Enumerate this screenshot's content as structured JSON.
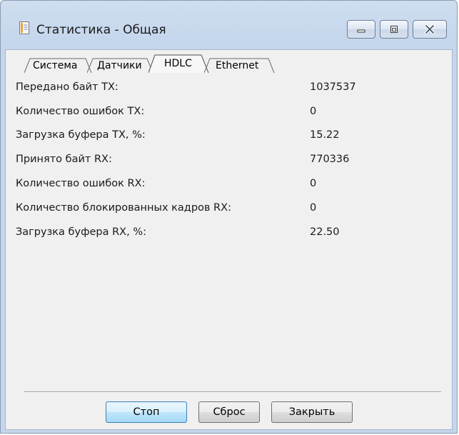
{
  "window": {
    "title": "Статистика - Общая",
    "caption_buttons": [
      "minimize-icon",
      "maximize-icon",
      "close-icon"
    ]
  },
  "tabs": [
    {
      "label": "Система",
      "active": false
    },
    {
      "label": "Датчики",
      "active": false
    },
    {
      "label": "HDLC",
      "active": true
    },
    {
      "label": "Ethernet",
      "active": false
    }
  ],
  "stats": [
    {
      "label": "Передано байт TX:",
      "value": "1037537"
    },
    {
      "label": "Количество ошибок TX:",
      "value": "0"
    },
    {
      "label": "Загрузка буфера TX, %:",
      "value": "15.22"
    },
    {
      "label": "Принято байт RX:",
      "value": "770336"
    },
    {
      "label": "Количество ошибок RX:",
      "value": "0"
    },
    {
      "label": "Количество блокированных кадров RX:",
      "value": "0"
    },
    {
      "label": "Загрузка буфера RX, %:",
      "value": "22.50"
    }
  ],
  "buttons": {
    "stop": "Стоп",
    "reset": "Сброс",
    "close": "Закрыть"
  },
  "colors": {
    "frame": "#c4d6ec",
    "client": "#f0f0f0",
    "default_button": "#bee6fd"
  }
}
